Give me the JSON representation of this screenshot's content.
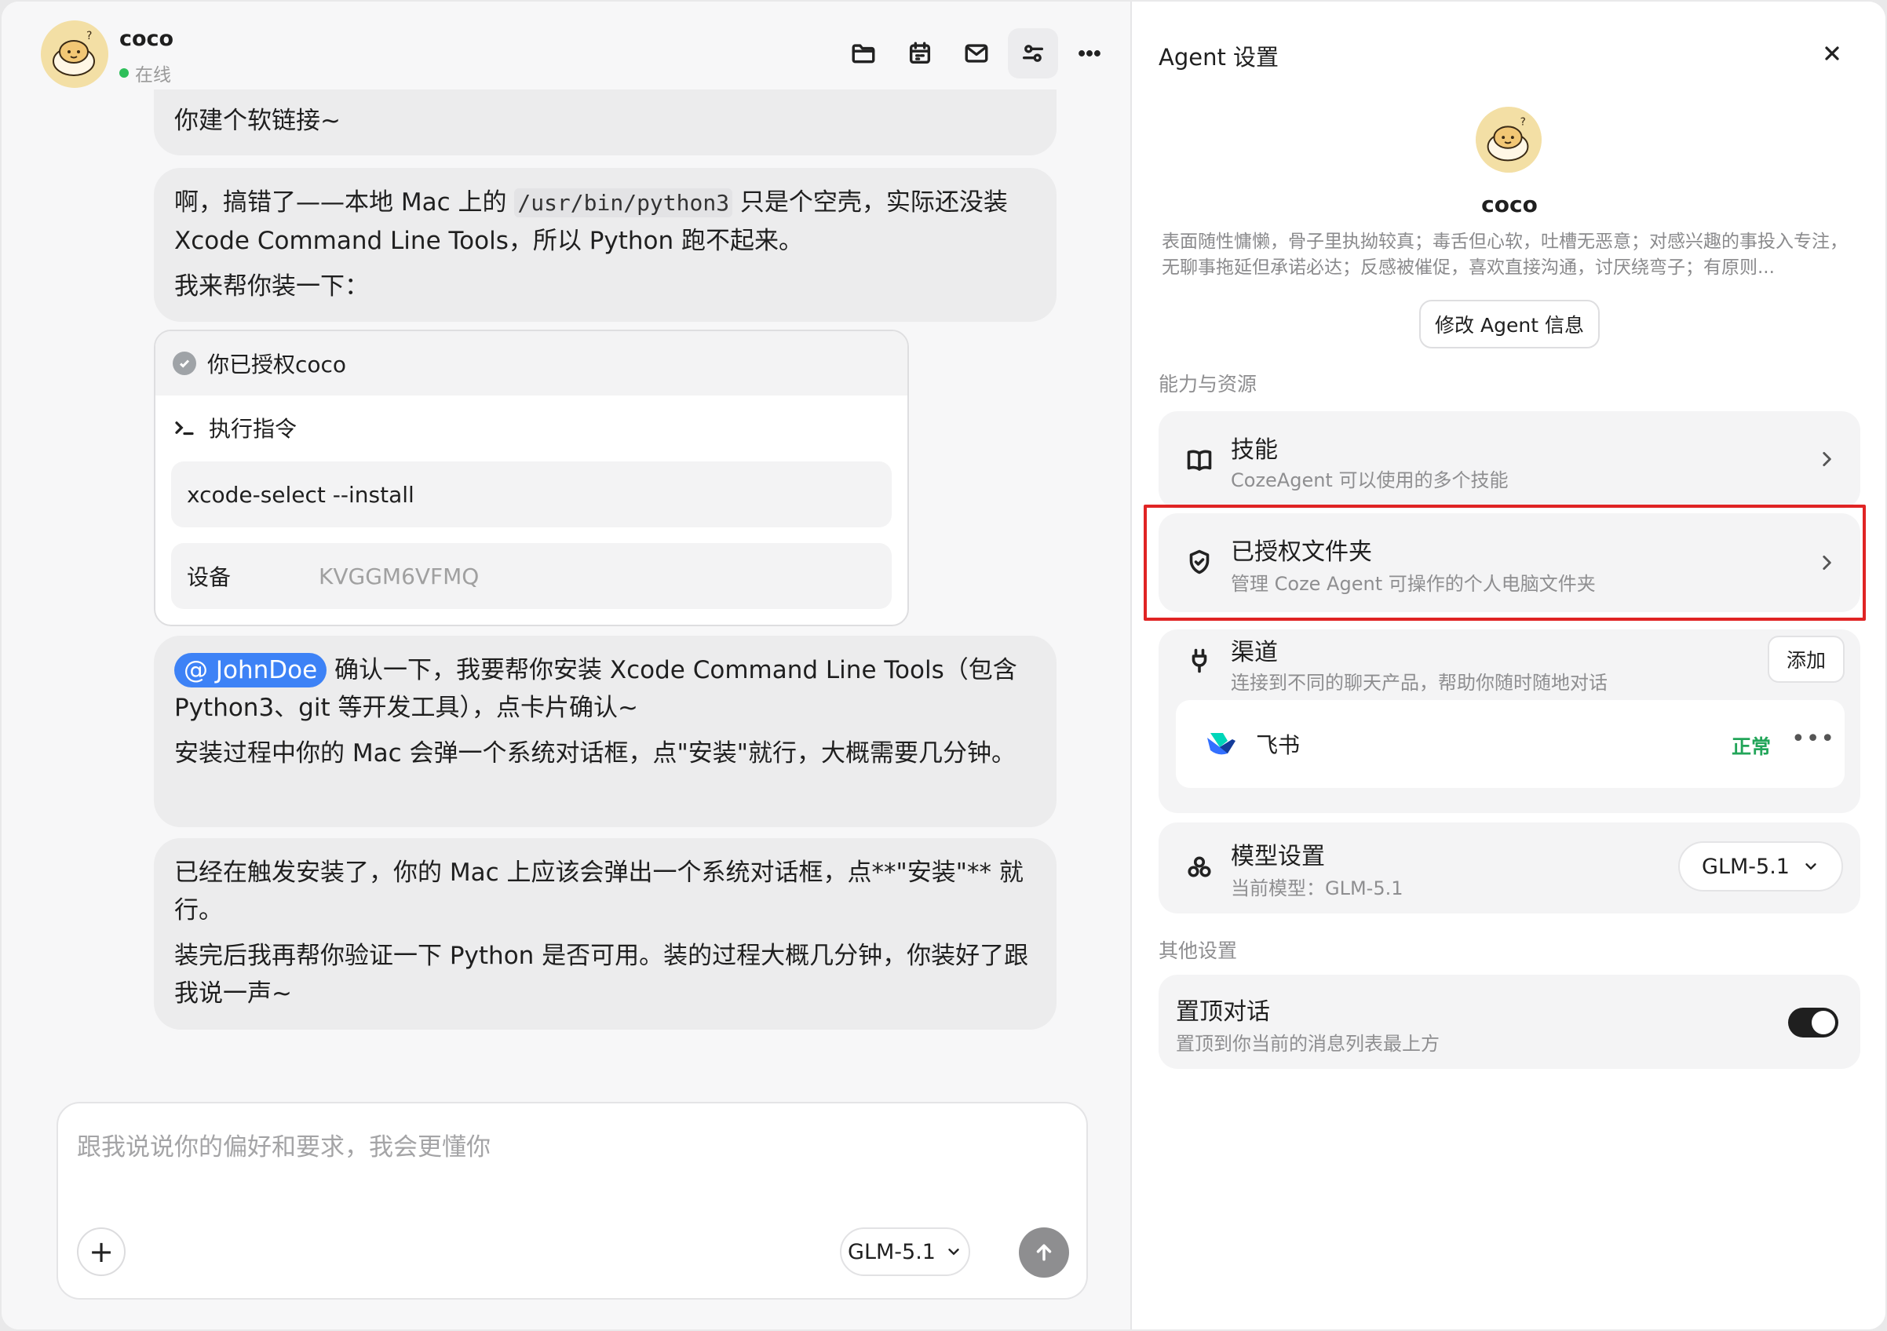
{
  "chat": {
    "agent_name": "coco",
    "status": "在线",
    "header_icons": [
      "folder-icon",
      "calendar-icon",
      "mail-icon",
      "settings-sliders-icon",
      "more-icon"
    ],
    "messages": {
      "m0": {
        "p1": "你建个软链接~"
      },
      "m1": {
        "p1_before": "啊，搞错了——本地 Mac 上的 ",
        "p1_code": "/usr/bin/python3",
        "p1_after": " 只是个空壳，实际还没装 Xcode Command Line Tools，所以 Python 跑不起来。",
        "p2": "我来帮你装一下："
      },
      "m2": {
        "mention": "@ JohnDoe",
        "p1_after": " 确认一下，我要帮你安装 Xcode Command Line Tools（包含 Python3、git 等开发工具），点卡片确认~",
        "p2": "安装过程中你的 Mac 会弹一个系统对话框，点\"安装\"就行，大概需要几分钟。"
      },
      "m3": {
        "p1": "已经在触发安装了，你的 Mac 上应该会弹出一个系统对话框，点**\"安装\"** 就行。",
        "p2": "装完后我再帮你验证一下 Python 是否可用。装的过程大概几分钟，你装好了跟我说一声~"
      }
    },
    "auth_card": {
      "header": "你已授权coco",
      "exec_label": "执行指令",
      "command": "xcode-select --install",
      "device_label": "设备",
      "device_value": "KVGGM6VFMQ"
    },
    "input": {
      "placeholder": "跟我说说你的偏好和要求，我会更懂你",
      "value": "",
      "model": "GLM-5.1"
    }
  },
  "settings": {
    "title": "Agent 设置",
    "agent_name": "coco",
    "description": "表面随性慵懒，骨子里执拗较真；毒舌但心软，吐槽无恶意；对感兴趣的事投入专注，无聊事拖延但承诺必达；反感被催促，喜欢直接沟通，讨厌绕弯子；有原则...",
    "edit_button": "修改 Agent 信息",
    "section_capabilities": "能力与资源",
    "skills": {
      "title": "技能",
      "subtitle": "CozeAgent 可以使用的多个技能"
    },
    "folders": {
      "title": "已授权文件夹",
      "subtitle": "管理 Coze Agent 可操作的个人电脑文件夹"
    },
    "channels": {
      "title": "渠道",
      "subtitle": "连接到不同的聊天产品，帮助你随时随地对话",
      "add_button": "添加",
      "items": [
        {
          "name": "飞书",
          "status": "正常"
        }
      ]
    },
    "model": {
      "title": "模型设置",
      "subtitle": "当前模型：GLM-5.1",
      "selected": "GLM-5.1"
    },
    "section_other": "其他设置",
    "pin": {
      "title": "置顶对话",
      "subtitle": "置顶到你当前的消息列表最上方",
      "enabled": true
    },
    "colors": {
      "highlight": "#e02424",
      "status_ok": "#22a559",
      "mention": "#3d82f6"
    }
  }
}
